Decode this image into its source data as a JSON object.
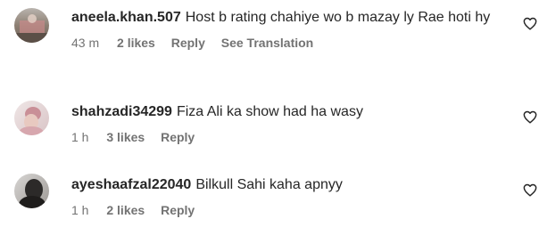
{
  "comments": [
    {
      "username": "aneela.khan.507",
      "text": "Host b rating chahiye wo b mazay ly Rae hoti hy",
      "time": "43 m",
      "likes": "2 likes",
      "reply": "Reply",
      "translate": "See Translation",
      "avatar_icon": "profile-photo",
      "like_icon": "heart-outline-icon"
    },
    {
      "username": "shahzadi34299",
      "text": "Fiza Ali ka show had ha wasy",
      "time": "1 h",
      "likes": "3 likes",
      "reply": "Reply",
      "avatar_icon": "profile-photo",
      "like_icon": "heart-outline-icon"
    },
    {
      "username": "ayeshaafzal22040",
      "text": "Bilkull Sahi kaha apnyy",
      "time": "1 h",
      "likes": "2 likes",
      "reply": "Reply",
      "avatar_icon": "profile-photo",
      "like_icon": "heart-outline-icon"
    }
  ],
  "colors": {
    "text": "#262626",
    "secondary": "#737373",
    "background": "#ffffff"
  }
}
